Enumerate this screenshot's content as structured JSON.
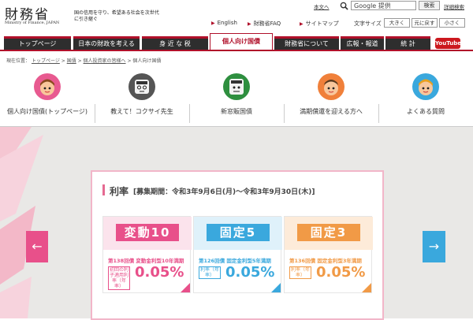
{
  "header": {
    "logo_kanji": "財務省",
    "logo_en": "Ministry of Finance, JAPAN",
    "tagline": "国の信用を守り、希望ある社会を次世代に引き継ぐ",
    "util_links": [
      "本文へ",
      "詳細検索"
    ],
    "search": {
      "placeholder": "Google 提供",
      "button": "検索"
    },
    "sub_links": [
      "English",
      "財務省FAQ",
      "サイトマップ"
    ],
    "font_size_label": "文字サイズ",
    "font_buttons": [
      "大きく",
      "元に戻す",
      "小さく"
    ]
  },
  "nav": {
    "items": [
      "トップページ",
      "日本の財政を考える",
      "身 近 な 税",
      "個人向け国債",
      "財務省について",
      "広報・報道",
      "統 計"
    ],
    "youtube": "YouTube"
  },
  "breadcrumb": {
    "prefix": "現在位置：",
    "items": [
      "トップページ",
      "国債",
      "個人投資家の皆様へ",
      "個人向け国債"
    ]
  },
  "categories": [
    {
      "label": "個人向け国債(トップページ)"
    },
    {
      "label": "教えて！コクサイ先生"
    },
    {
      "label": "新窓販国債"
    },
    {
      "label": "満期償還を迎える方へ"
    },
    {
      "label": "よくある質問"
    }
  ],
  "rate": {
    "title": "利率",
    "period": "[募集期間：令和3年9月6日(月)〜令和3年9月30日(木)]",
    "cards": [
      {
        "badge": "変動10",
        "subtitle": "第138回債 変動金利型10年満期",
        "label": "初回の利子適用利率（年率）",
        "value": "0.05%",
        "color": "#e8508a"
      },
      {
        "badge": "固定5",
        "subtitle": "第126回債 固定金利型5年満期",
        "label": "利率（年率）",
        "value": "0.05%",
        "color": "#3aa8dd"
      },
      {
        "badge": "固定3",
        "subtitle": "第136回債 固定金利型3年満期",
        "label": "利率（年率）",
        "value": "0.05%",
        "color": "#f19a46"
      }
    ]
  },
  "carousel": {
    "prev": "←",
    "next": "→"
  }
}
